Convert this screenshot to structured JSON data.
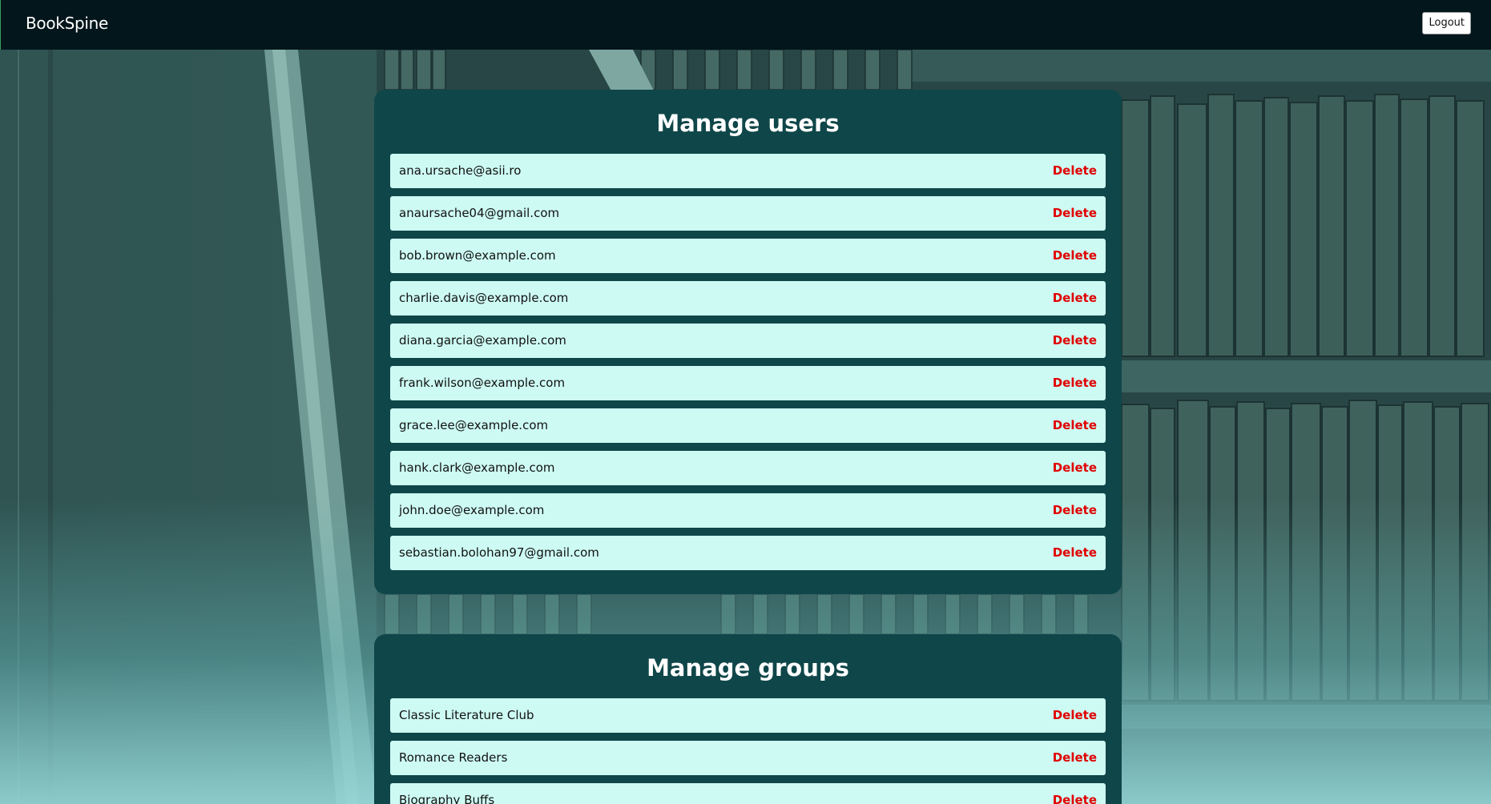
{
  "navbar": {
    "brand": "BookSpine",
    "logout_label": "Logout"
  },
  "users_panel": {
    "title": "Manage users",
    "delete_label": "Delete",
    "items": [
      "ana.ursache@asii.ro",
      "anaursache04@gmail.com",
      "bob.brown@example.com",
      "charlie.davis@example.com",
      "diana.garcia@example.com",
      "frank.wilson@example.com",
      "grace.lee@example.com",
      "hank.clark@example.com",
      "john.doe@example.com",
      "sebastian.bolohan97@gmail.com"
    ]
  },
  "groups_panel": {
    "title": "Manage groups",
    "delete_label": "Delete",
    "items": [
      "Classic Literature Club",
      "Romance Readers",
      "Biography Buffs"
    ]
  },
  "colors": {
    "navbar_bg": "#03161c",
    "panel_bg": "#0f4649",
    "row_bg": "#cdfbf3",
    "delete_text": "#e00000"
  }
}
